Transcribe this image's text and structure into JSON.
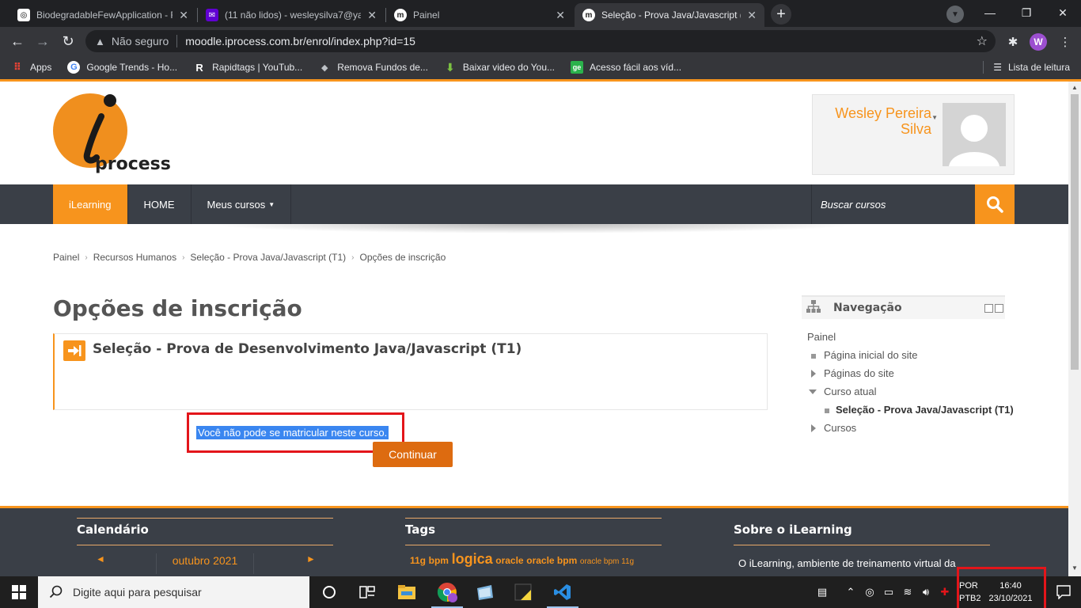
{
  "browser": {
    "tabs": [
      {
        "title": "BiodegradableFewApplication - F",
        "close": "✕"
      },
      {
        "title": "(11 não lidos) - wesleysilva7@ya",
        "close": "✕"
      },
      {
        "title": "Painel",
        "close": "✕"
      },
      {
        "title": "Seleção - Prova Java/Javascript (T",
        "close": "✕"
      }
    ],
    "new_tab": "+",
    "address": {
      "security": "Não seguro",
      "url": "moodle.iprocess.com.br/enrol/index.php?id=15"
    },
    "profile_initial": "W",
    "bookmarks": [
      {
        "label": "Apps"
      },
      {
        "label": "Google Trends - Ho..."
      },
      {
        "label": "Rapidtags | YouTub..."
      },
      {
        "label": "Remova Fundos de..."
      },
      {
        "label": "Baixar video do You..."
      },
      {
        "label": "Acesso fácil aos víd..."
      }
    ],
    "reading_list": "Lista de leitura"
  },
  "site": {
    "logo_text": "process",
    "user": {
      "name_line1": "Wesley Pereira",
      "name_line2": "Silva"
    },
    "nav": {
      "brand": "iLearning",
      "home": "HOME",
      "my_courses": "Meus cursos",
      "search_placeholder": "Buscar cursos"
    },
    "breadcrumb": [
      "Painel",
      "Recursos Humanos",
      "Seleção - Prova Java/Javascript (T1)",
      "Opções de inscrição"
    ],
    "page_title": "Opções de inscrição",
    "course_title": "Seleção - Prova de Desenvolvimento Java/Javascript (T1)",
    "notice": "Você não pode se matricular neste curso.",
    "continue_label": "Continuar",
    "navigation": {
      "title": "Navegação",
      "items": [
        {
          "label": "Painel"
        },
        {
          "label": "Página inicial do site"
        },
        {
          "label": "Páginas do site"
        },
        {
          "label": "Curso atual"
        },
        {
          "label": "Seleção - Prova Java/Javascript (T1)"
        },
        {
          "label": "Cursos"
        }
      ]
    },
    "footer": {
      "calendar_title": "Calendário",
      "month": "outubro 2021",
      "prev": "◄",
      "next": "►",
      "tags_title": "Tags",
      "tags": [
        "11g",
        "bpm",
        "logica",
        "oracle",
        "oracle bpm",
        "oracle bpm 11g"
      ],
      "about_title": "Sobre o iLearning",
      "about_text": "O iLearning, ambiente de treinamento virtual da"
    }
  },
  "taskbar": {
    "search_placeholder": "Digite aqui para pesquisar",
    "lang_line1": "POR",
    "lang_line2": "PTB2",
    "time": "16:40",
    "date": "23/10/2021"
  },
  "colors": {
    "accent": "#f7941d",
    "navbar": "#3a3f47",
    "button": "#dd6b10",
    "highlight_box": "#e3151a",
    "selection": "#3a86f0"
  }
}
